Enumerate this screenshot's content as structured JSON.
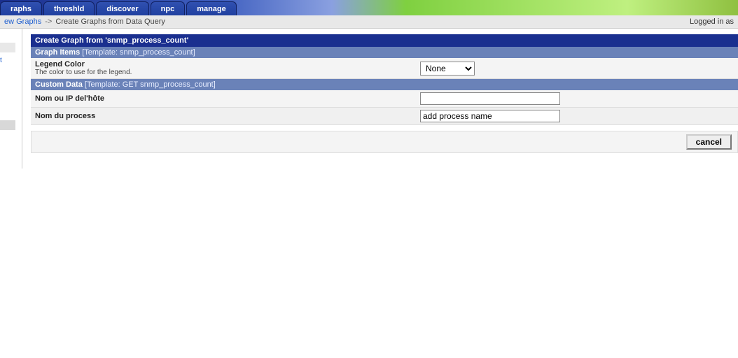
{
  "tabs": {
    "t1": "raphs",
    "t2": "threshld",
    "t3": "discover",
    "t4": "npc",
    "t5": "manage"
  },
  "breadcrumb": {
    "link": "ew Graphs",
    "separator": "->",
    "current": "Create Graphs from Data Query",
    "logged_in": "Logged in as"
  },
  "sidebar": {
    "link1": "t"
  },
  "panel": {
    "title": "Create Graph from 'snmp_process_count'"
  },
  "section1": {
    "label": "Graph Items",
    "template": "[Template: snmp_process_count]",
    "row1": {
      "title": "Legend Color",
      "desc": "The color to use for the legend.",
      "selected": "None"
    }
  },
  "section2": {
    "label": "Custom Data",
    "template": "[Template: GET snmp_process_count]",
    "row1": {
      "title": "Nom ou IP del'hôte",
      "value": ""
    },
    "row2": {
      "title": "Nom du process",
      "value": "add process name"
    }
  },
  "buttons": {
    "cancel": "cancel"
  }
}
